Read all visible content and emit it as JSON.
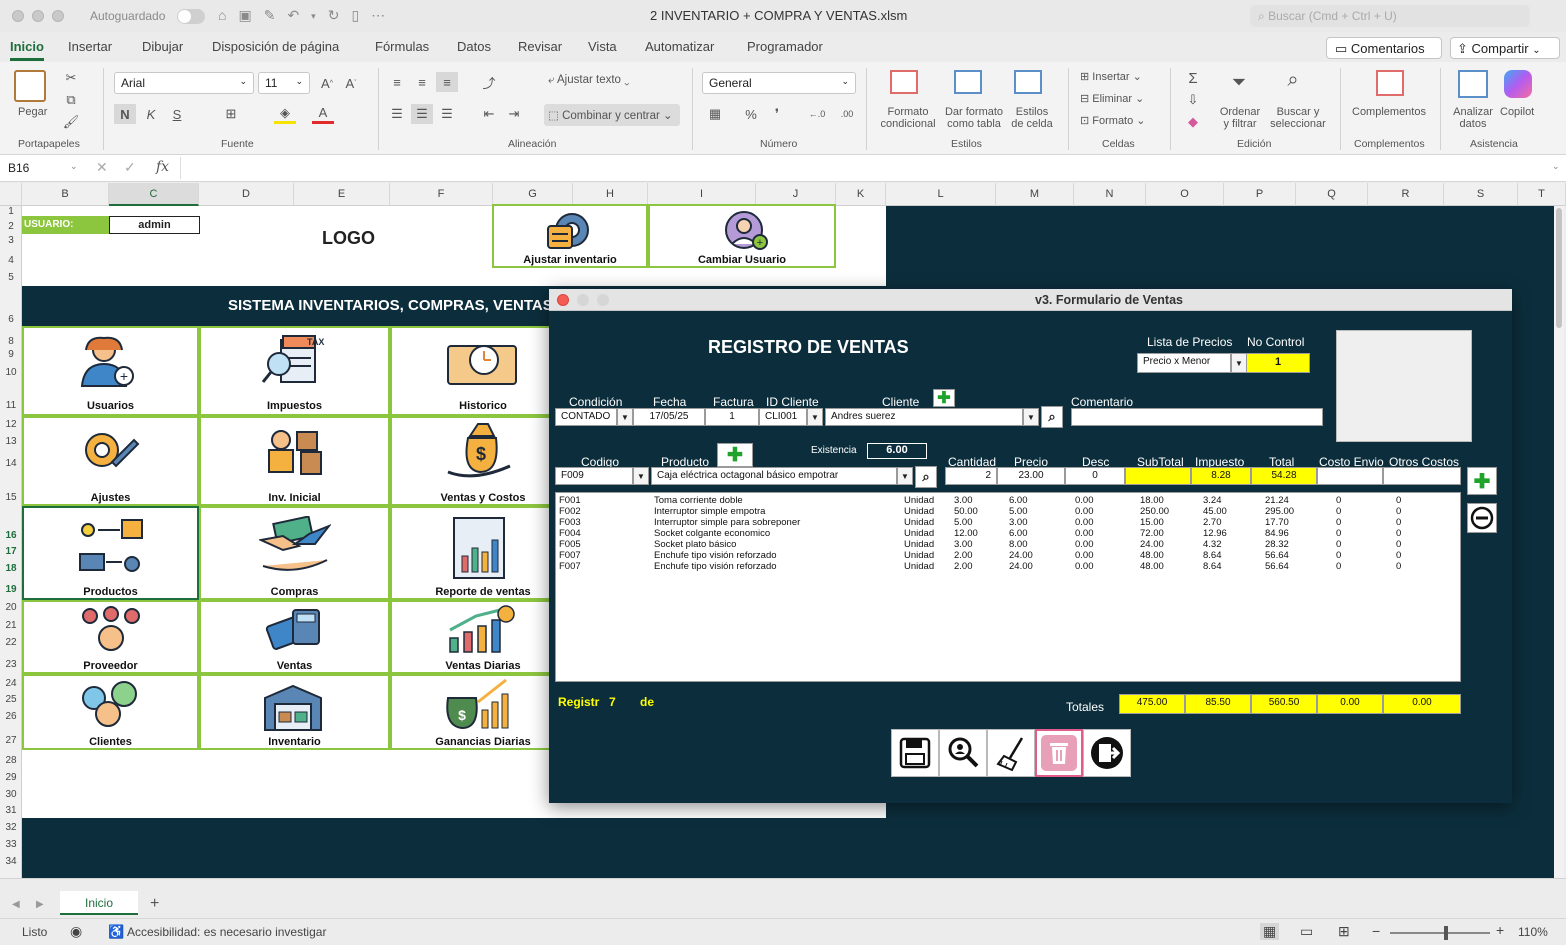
{
  "window": {
    "autosave_label": "Autoguardado",
    "file_title": "2 INVENTARIO + COMPRA Y VENTAS.xlsm",
    "search_placeholder": "Buscar (Cmd + Ctrl + U)"
  },
  "ribbon_tabs": [
    "Inicio",
    "Insertar",
    "Dibujar",
    "Disposición de página",
    "Fórmulas",
    "Datos",
    "Revisar",
    "Vista",
    "Automatizar",
    "Programador"
  ],
  "ribbon_actions": {
    "comments": "Comentarios",
    "share": "Compartir"
  },
  "ribbon": {
    "paste": "Pegar",
    "font_name": "Arial",
    "font_size": "11",
    "wrap_text": "Ajustar texto",
    "merge_center": "Combinar y centrar",
    "number_format": "General",
    "cond_format": [
      "Formato",
      "condicional"
    ],
    "format_table": [
      "Dar formato",
      "como tabla"
    ],
    "cell_styles": [
      "Estilos",
      "de celda"
    ],
    "insert": "Insertar",
    "delete": "Eliminar",
    "format": "Formato",
    "sort_filter": [
      "Ordenar",
      "y filtrar"
    ],
    "find_select": [
      "Buscar y",
      "seleccionar"
    ],
    "addins": "Complementos",
    "analyze": [
      "Analizar",
      "datos"
    ],
    "copilot": "Copilot",
    "groups": [
      "Portapapeles",
      "Fuente",
      "Alineación",
      "Número",
      "Estilos",
      "Celdas",
      "Edición",
      "Complementos",
      "Asistencia"
    ]
  },
  "formula_bar": {
    "name_box": "B16",
    "fx": "fx",
    "formula": ""
  },
  "columns": [
    "B",
    "C",
    "D",
    "E",
    "F",
    "G",
    "H",
    "I",
    "J",
    "K",
    "L",
    "M",
    "N",
    "O",
    "P",
    "Q",
    "R",
    "S",
    "T"
  ],
  "rows": [
    "1",
    "2",
    "3",
    "4",
    "5",
    "6",
    "8",
    "9",
    "10",
    "11",
    "12",
    "13",
    "14",
    "15",
    "16",
    "17",
    "18",
    "19",
    "20",
    "21",
    "22",
    "23",
    "24",
    "25",
    "26",
    "27",
    "28",
    "29",
    "30",
    "31",
    "32",
    "33",
    "34"
  ],
  "sheet": {
    "user_label": "USUARIO:",
    "user_value": "admin",
    "logo": "LOGO",
    "adjust_inventory": "Ajustar inventario",
    "change_user": "Cambiar Usuario",
    "banner": "SISTEMA INVENTARIOS, COMPRAS, VENTAS Y C",
    "tiles": [
      "Usuarios",
      "Impuestos",
      "Historico",
      "Ajustes",
      "Inv. Inicial",
      "Ventas y Costos",
      "Productos",
      "Compras",
      "Reporte de ventas",
      "Proveedor",
      "Ventas",
      "Ventas Diarias",
      "Clientes",
      "Inventario",
      "Ganancias Diarias"
    ],
    "tax_text": "TAX"
  },
  "form": {
    "title": "v3. Formulario de Ventas",
    "heading": "REGISTRO DE VENTAS",
    "price_list_label": "Lista de Precios",
    "price_list_value": "Precio x Menor",
    "control_label": "No Control",
    "control_value": "1",
    "labels": {
      "condicion": "Condición",
      "fecha": "Fecha",
      "factura": "Factura",
      "id_cliente": "ID Cliente",
      "cliente": "Cliente",
      "comentario": "Comentario",
      "existencia": "Existencia",
      "codigo": "Codigo",
      "producto": "Producto",
      "cantidad": "Cantidad",
      "precio": "Precio",
      "desc": "Desc",
      "subtotal": "SubTotal",
      "impuesto": "Impuesto",
      "total": "Total",
      "costo_envio": "Costo Envio",
      "otros_costos": "Otros Costos"
    },
    "values": {
      "condicion": "CONTADO",
      "fecha": "17/05/25",
      "factura": "1",
      "id_cliente": "CLI001",
      "cliente": "Andres suerez",
      "comentario": "",
      "existencia": "6.00",
      "codigo": "F009",
      "producto": "Caja eléctrica octagonal básico empotrar",
      "cantidad": "2",
      "precio": "23.00",
      "desc": "0",
      "subtotal": "",
      "impuesto": "8.28",
      "total": "54.28",
      "costo_envio": "",
      "otros_costos": ""
    },
    "lines": [
      {
        "code": "F001",
        "product": "Toma corriente doble",
        "unit": "Unidad",
        "qty": "3.00",
        "price": "6.00",
        "desc": "0.00",
        "subtotal": "18.00",
        "tax": "3.24",
        "total": "21.24",
        "ship": "0",
        "other": "0"
      },
      {
        "code": "F002",
        "product": "Interruptor simple empotra",
        "unit": "Unidad",
        "qty": "50.00",
        "price": "5.00",
        "desc": "0.00",
        "subtotal": "250.00",
        "tax": "45.00",
        "total": "295.00",
        "ship": "0",
        "other": "0"
      },
      {
        "code": "F003",
        "product": "Interruptor simple  para sobreponer",
        "unit": "Unidad",
        "qty": "5.00",
        "price": "3.00",
        "desc": "0.00",
        "subtotal": "15.00",
        "tax": "2.70",
        "total": "17.70",
        "ship": "0",
        "other": "0"
      },
      {
        "code": "F004",
        "product": "Socket colgante economico",
        "unit": "Unidad",
        "qty": "12.00",
        "price": "6.00",
        "desc": "0.00",
        "subtotal": "72.00",
        "tax": "12.96",
        "total": "84.96",
        "ship": "0",
        "other": "0"
      },
      {
        "code": "F005",
        "product": "Socket plato básico",
        "unit": "Unidad",
        "qty": "3.00",
        "price": "8.00",
        "desc": "0.00",
        "subtotal": "24.00",
        "tax": "4.32",
        "total": "28.32",
        "ship": "0",
        "other": "0"
      },
      {
        "code": "F007",
        "product": "Enchufe tipo visión reforzado",
        "unit": "Unidad",
        "qty": "2.00",
        "price": "24.00",
        "desc": "0.00",
        "subtotal": "48.00",
        "tax": "8.64",
        "total": "56.64",
        "ship": "0",
        "other": "0"
      },
      {
        "code": "F007",
        "product": "Enchufe tipo visión reforzado",
        "unit": "Unidad",
        "qty": "2.00",
        "price": "24.00",
        "desc": "0.00",
        "subtotal": "48.00",
        "tax": "8.64",
        "total": "56.64",
        "ship": "0",
        "other": "0"
      }
    ],
    "registro_label": "Registr",
    "registro_count": "7",
    "registro_de": "de",
    "totals_label": "Totales",
    "totals": {
      "subtotal": "475.00",
      "tax": "85.50",
      "total": "560.50",
      "ship": "0.00",
      "other": "0.00"
    }
  },
  "sheet_tab": "Inicio",
  "status": {
    "ready": "Listo",
    "accessibility": "Accesibilidad: es necesario investigar",
    "zoom": "110%"
  },
  "colors": {
    "dark": "#0c2e3c",
    "green": "#8cc63f",
    "yellow": "#ffff00",
    "accent": "#1e6e3c"
  }
}
